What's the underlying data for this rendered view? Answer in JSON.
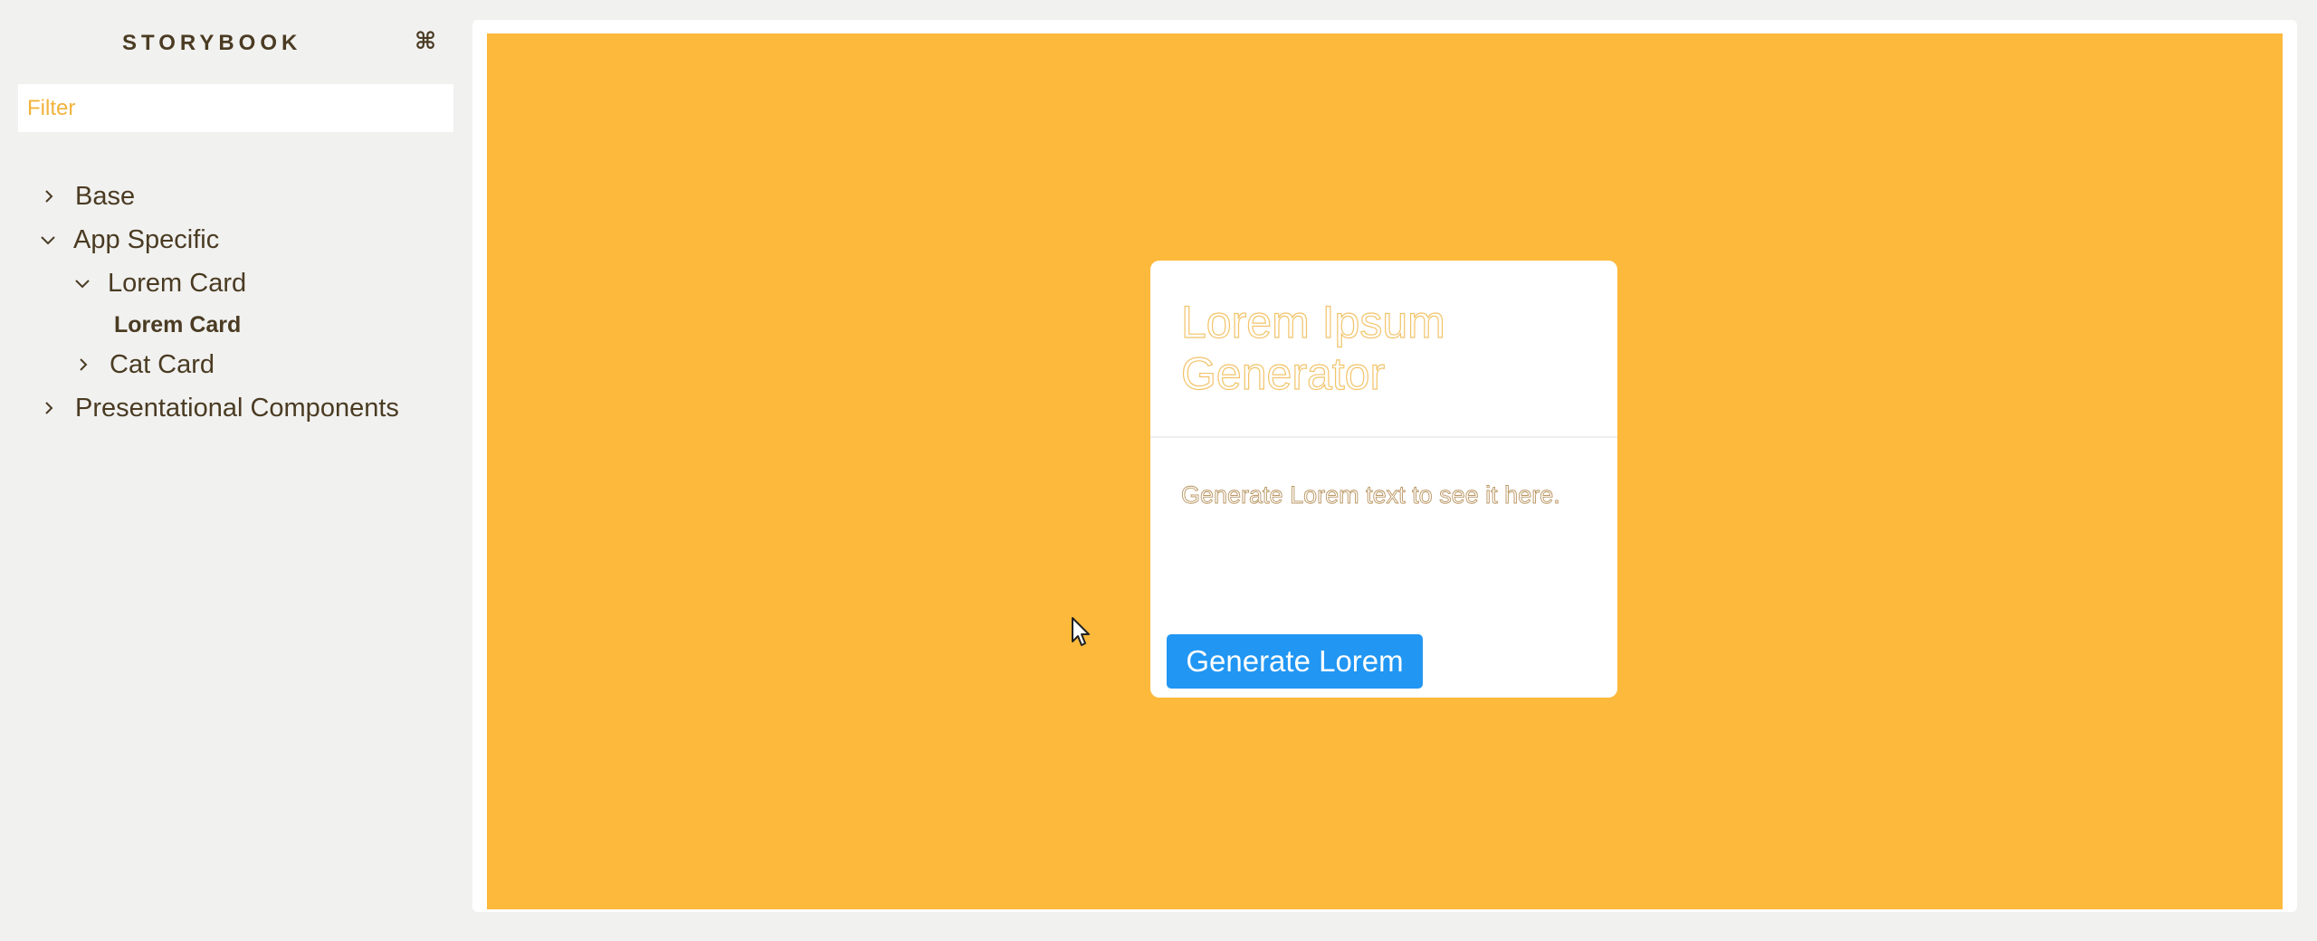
{
  "sidebar": {
    "brand": "STORYBOOK",
    "shortcut_glyph": "⌘",
    "filter": {
      "placeholder": "Filter",
      "value": ""
    },
    "tree": {
      "base": {
        "label": "Base",
        "expanded": false
      },
      "app_specific": {
        "label": "App Specific",
        "expanded": true
      },
      "lorem_card_group": {
        "label": "Lorem Card",
        "expanded": true
      },
      "lorem_card_story": {
        "label": "Lorem Card",
        "selected": true
      },
      "cat_card": {
        "label": "Cat Card",
        "expanded": false
      },
      "presentational": {
        "label": "Presentational Components",
        "expanded": false
      }
    }
  },
  "preview": {
    "background_color": "#fcb93b",
    "card": {
      "title": "Lorem Ipsum Generator",
      "body": "Generate Lorem text to see it here.",
      "button_label": "Generate Lorem",
      "button_color": "#2196f3"
    }
  },
  "icons": {
    "collapsed": "chevron-right-icon",
    "expanded": "chevron-down-icon",
    "pointer": "mouse-cursor-icon"
  }
}
